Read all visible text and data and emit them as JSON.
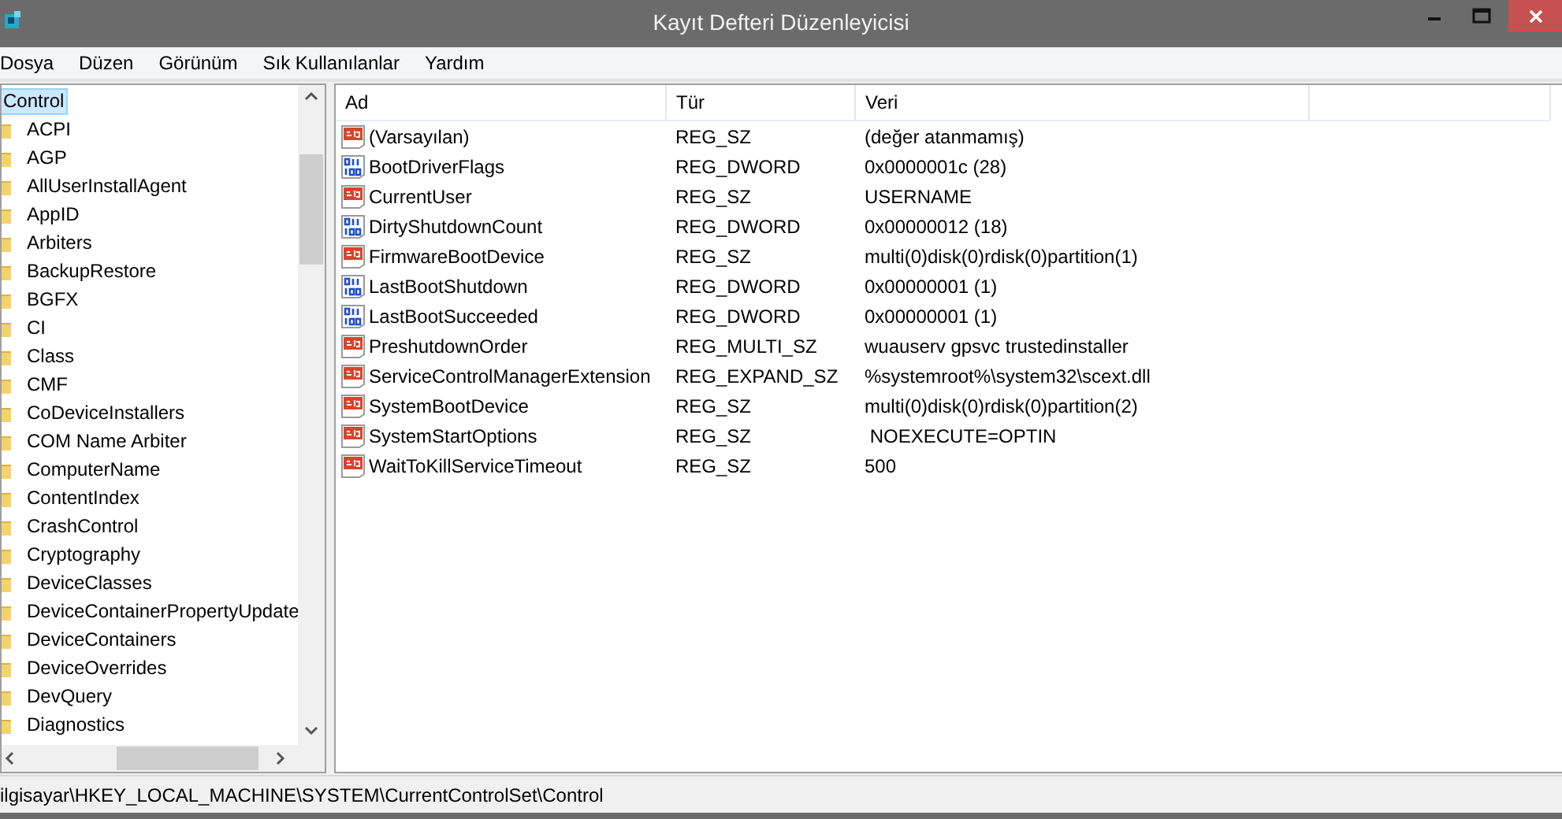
{
  "window": {
    "title": "Kayıt Defteri Düzenleyicisi"
  },
  "menu": [
    "Dosya",
    "Düzen",
    "Görünüm",
    "Sık Kullanılanlar",
    "Yardım"
  ],
  "tree": {
    "items": [
      {
        "label": "Control",
        "selected": true
      },
      {
        "label": "ACPI",
        "selected": false
      },
      {
        "label": "AGP",
        "selected": false
      },
      {
        "label": "AllUserInstallAgent",
        "selected": false
      },
      {
        "label": "AppID",
        "selected": false
      },
      {
        "label": "Arbiters",
        "selected": false
      },
      {
        "label": "BackupRestore",
        "selected": false
      },
      {
        "label": "BGFX",
        "selected": false
      },
      {
        "label": "CI",
        "selected": false
      },
      {
        "label": "Class",
        "selected": false
      },
      {
        "label": "CMF",
        "selected": false
      },
      {
        "label": "CoDeviceInstallers",
        "selected": false
      },
      {
        "label": "COM Name Arbiter",
        "selected": false
      },
      {
        "label": "ComputerName",
        "selected": false
      },
      {
        "label": "ContentIndex",
        "selected": false
      },
      {
        "label": "CrashControl",
        "selected": false
      },
      {
        "label": "Cryptography",
        "selected": false
      },
      {
        "label": "DeviceClasses",
        "selected": false
      },
      {
        "label": "DeviceContainerPropertyUpdate",
        "selected": false
      },
      {
        "label": "DeviceContainers",
        "selected": false
      },
      {
        "label": "DeviceOverrides",
        "selected": false
      },
      {
        "label": "DevQuery",
        "selected": false
      },
      {
        "label": "Diagnostics",
        "selected": false
      }
    ]
  },
  "table": {
    "columns": [
      "Ad",
      "Tür",
      "Veri"
    ],
    "rows": [
      {
        "kind": "string",
        "name": "(Varsayılan)",
        "type": "REG_SZ",
        "data": "(değer atanmamış)"
      },
      {
        "kind": "binary",
        "name": "BootDriverFlags",
        "type": "REG_DWORD",
        "data": "0x0000001c (28)"
      },
      {
        "kind": "string",
        "name": "CurrentUser",
        "type": "REG_SZ",
        "data": "USERNAME"
      },
      {
        "kind": "binary",
        "name": "DirtyShutdownCount",
        "type": "REG_DWORD",
        "data": "0x00000012 (18)"
      },
      {
        "kind": "string",
        "name": "FirmwareBootDevice",
        "type": "REG_SZ",
        "data": "multi(0)disk(0)rdisk(0)partition(1)"
      },
      {
        "kind": "binary",
        "name": "LastBootShutdown",
        "type": "REG_DWORD",
        "data": "0x00000001 (1)"
      },
      {
        "kind": "binary",
        "name": "LastBootSucceeded",
        "type": "REG_DWORD",
        "data": "0x00000001 (1)"
      },
      {
        "kind": "string",
        "name": "PreshutdownOrder",
        "type": "REG_MULTI_SZ",
        "data": "wuauserv gpsvc trustedinstaller"
      },
      {
        "kind": "string",
        "name": "ServiceControlManagerExtension",
        "type": "REG_EXPAND_SZ",
        "data": "%systemroot%\\system32\\scext.dll"
      },
      {
        "kind": "string",
        "name": "SystemBootDevice",
        "type": "REG_SZ",
        "data": "multi(0)disk(0)rdisk(0)partition(2)"
      },
      {
        "kind": "string",
        "name": "SystemStartOptions",
        "type": "REG_SZ",
        "data": " NOEXECUTE=OPTIN"
      },
      {
        "kind": "string",
        "name": "WaitToKillServiceTimeout",
        "type": "REG_SZ",
        "data": "500"
      }
    ]
  },
  "status_bar": "ilgisayar\\HKEY_LOCAL_MACHINE\\SYSTEM\\CurrentControlSet\\Control"
}
